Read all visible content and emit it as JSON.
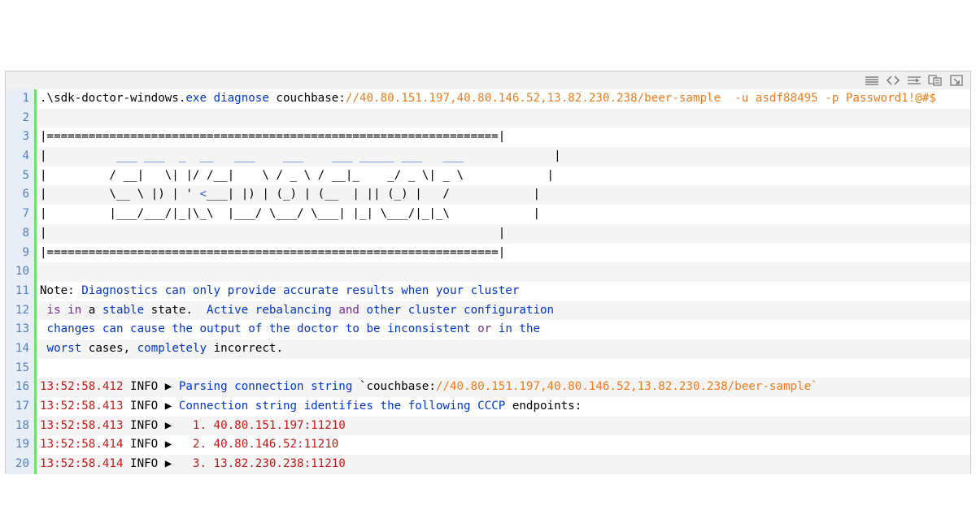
{
  "toolbar": {
    "icons": [
      "view-source-icon",
      "toggle-plain-icon",
      "wrap-icon",
      "copy-icon",
      "print-icon"
    ]
  },
  "lines": [
    {
      "n": "1",
      "parts": [
        {
          "t": ".\\sdk-doctor-windows.",
          "c": "plaintxt"
        },
        {
          "t": "exe",
          "c": "kw"
        },
        {
          "t": " ",
          "c": "plaintxt"
        },
        {
          "t": "diagnose",
          "c": "kw"
        },
        {
          "t": " couchbase:",
          "c": "plaintxt"
        },
        {
          "t": "//40.80.151.197,40.80.146.52,13.82.230.238/beer-sample  -u asdf88495 -p Password1!@#$",
          "c": "str"
        }
      ]
    },
    {
      "n": "2",
      "parts": []
    },
    {
      "n": "3",
      "parts": [
        {
          "t": "|=================================================================|",
          "c": "plaintxt"
        }
      ]
    },
    {
      "n": "4",
      "parts": [
        {
          "t": "|          ",
          "c": "plaintxt"
        },
        {
          "t": "___ ___  _  __   ___    ___    ___ _____ ___   ___",
          "c": "ascii"
        },
        {
          "t": "             |",
          "c": "plaintxt"
        }
      ]
    },
    {
      "n": "5",
      "parts": [
        {
          "t": "|         / __|   \\| |/ /__|    \\ / _ \\ / __|_    _/ _ \\| _ \\            |",
          "c": "plaintxt"
        }
      ]
    },
    {
      "n": "6",
      "parts": [
        {
          "t": "|         \\__ \\ |) | ' ",
          "c": "plaintxt"
        },
        {
          "t": "<",
          "c": "ascii"
        },
        {
          "t": "___| |) | (_) | (__  | || (_) |   /            |",
          "c": "plaintxt"
        }
      ]
    },
    {
      "n": "7",
      "parts": [
        {
          "t": "|         |___/___/|_|\\_\\  |___/ \\___/ \\___| |_| \\___/|_|_\\            |",
          "c": "plaintxt"
        }
      ]
    },
    {
      "n": "8",
      "parts": [
        {
          "t": "|                                                                 |",
          "c": "plaintxt"
        }
      ]
    },
    {
      "n": "9",
      "parts": [
        {
          "t": "|=================================================================|",
          "c": "plaintxt"
        }
      ]
    },
    {
      "n": "10",
      "parts": []
    },
    {
      "n": "11",
      "parts": [
        {
          "t": "Note: ",
          "c": "plaintxt"
        },
        {
          "t": "Diagnostics can only provide accurate results when your cluster",
          "c": "kw"
        }
      ]
    },
    {
      "n": "12",
      "parts": [
        {
          "t": " ",
          "c": "plaintxt"
        },
        {
          "t": "is in",
          "c": "purple"
        },
        {
          "t": " a ",
          "c": "plaintxt"
        },
        {
          "t": "stable",
          "c": "kw"
        },
        {
          "t": " state.  ",
          "c": "plaintxt"
        },
        {
          "t": "Active rebalancing ",
          "c": "kw"
        },
        {
          "t": "and",
          "c": "purple"
        },
        {
          "t": " other cluster configuration",
          "c": "kw"
        }
      ]
    },
    {
      "n": "13",
      "parts": [
        {
          "t": " ",
          "c": "plaintxt"
        },
        {
          "t": "changes can cause the output of the doctor to be inconsistent ",
          "c": "kw"
        },
        {
          "t": "or",
          "c": "purple"
        },
        {
          "t": " ",
          "c": "plaintxt"
        },
        {
          "t": "in the",
          "c": "kw"
        }
      ]
    },
    {
      "n": "14",
      "parts": [
        {
          "t": " ",
          "c": "plaintxt"
        },
        {
          "t": "worst",
          "c": "kw"
        },
        {
          "t": " cases, ",
          "c": "plaintxt"
        },
        {
          "t": "completely",
          "c": "kw"
        },
        {
          "t": " incorrect.",
          "c": "plaintxt"
        }
      ]
    },
    {
      "n": "15",
      "parts": []
    },
    {
      "n": "16",
      "parts": [
        {
          "t": "13:52:58.412",
          "c": "red"
        },
        {
          "t": " INFO ▶ ",
          "c": "plaintxt"
        },
        {
          "t": "Parsing connection string",
          "c": "kw"
        },
        {
          "t": " `couchbase:",
          "c": "plaintxt"
        },
        {
          "t": "//40.80.151.197,40.80.146.52,13.82.230.238/beer-sample`",
          "c": "str"
        }
      ]
    },
    {
      "n": "17",
      "parts": [
        {
          "t": "13:52:58.413",
          "c": "red"
        },
        {
          "t": " INFO ▶ ",
          "c": "plaintxt"
        },
        {
          "t": "Connection string identifies the following CCCP",
          "c": "kw"
        },
        {
          "t": " endpoints:",
          "c": "plaintxt"
        }
      ]
    },
    {
      "n": "18",
      "parts": [
        {
          "t": "13:52:58.413",
          "c": "red"
        },
        {
          "t": " INFO ▶   ",
          "c": "plaintxt"
        },
        {
          "t": "1. 40.80.151.197:11210",
          "c": "red"
        }
      ]
    },
    {
      "n": "19",
      "parts": [
        {
          "t": "13:52:58.414",
          "c": "red"
        },
        {
          "t": " INFO ▶   ",
          "c": "plaintxt"
        },
        {
          "t": "2. 40.80.146.52:11210",
          "c": "red"
        }
      ]
    },
    {
      "n": "20",
      "parts": [
        {
          "t": "13:52:58.414",
          "c": "red"
        },
        {
          "t": " INFO ▶   ",
          "c": "plaintxt"
        },
        {
          "t": "3. 13.82.230.238:11210",
          "c": "red"
        }
      ]
    }
  ]
}
